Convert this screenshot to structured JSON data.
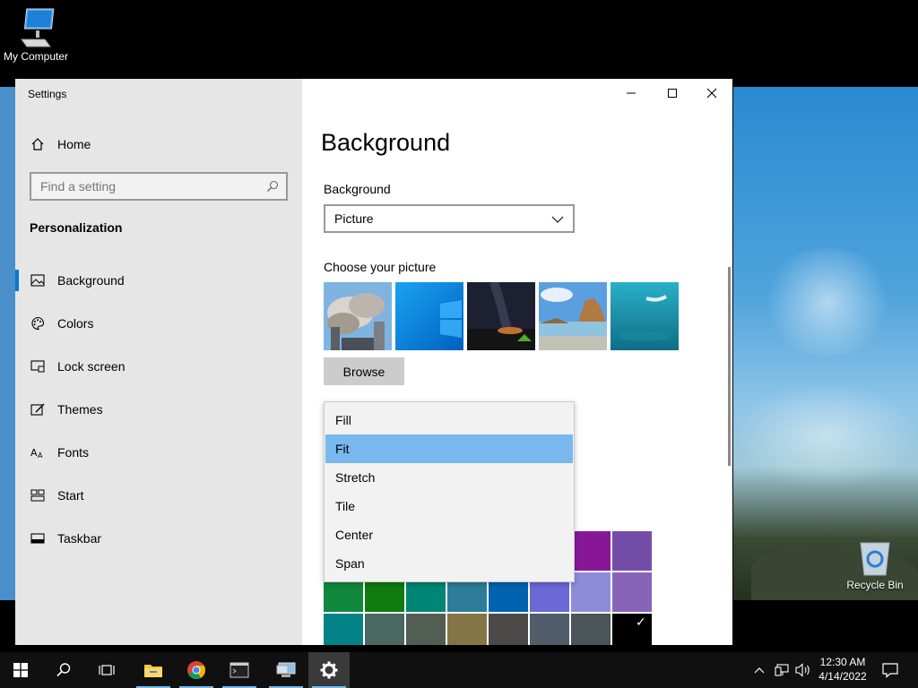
{
  "desktop": {
    "icons": [
      {
        "label": "My Computer"
      },
      {
        "label": "Recycle Bin"
      }
    ]
  },
  "window": {
    "title": "Settings",
    "controls": {
      "minimize": "minimize-icon",
      "maximize": "maximize-icon",
      "close": "close-icon"
    }
  },
  "sidebar": {
    "home_label": "Home",
    "search_placeholder": "Find a setting",
    "section_title": "Personalization",
    "items": [
      {
        "label": "Background",
        "icon": "picture-icon",
        "active": true
      },
      {
        "label": "Colors",
        "icon": "palette-icon"
      },
      {
        "label": "Lock screen",
        "icon": "lock-screen-icon"
      },
      {
        "label": "Themes",
        "icon": "themes-icon"
      },
      {
        "label": "Fonts",
        "icon": "fonts-icon"
      },
      {
        "label": "Start",
        "icon": "start-icon"
      },
      {
        "label": "Taskbar",
        "icon": "taskbar-icon"
      }
    ]
  },
  "main": {
    "title": "Background",
    "background_label": "Background",
    "background_value": "Picture",
    "choose_label": "Choose your picture",
    "browse_label": "Browse",
    "fit_options": [
      "Fill",
      "Fit",
      "Stretch",
      "Tile",
      "Center",
      "Span"
    ],
    "fit_selected": "Fit"
  },
  "colors": {
    "accent": "#0078d7",
    "swatches_row1": [
      "#881798",
      "#744da9"
    ],
    "swatches_row2": [
      "#10893e",
      "#107c10",
      "#018574",
      "#2d7d9a",
      "#0063b1",
      "#6b69d6",
      "#8e8cd8",
      "#8764b8"
    ],
    "swatches_row3": [
      "#038387",
      "#486860",
      "#525e54",
      "#847545",
      "#4c4a48",
      "#515c6b",
      "#4a5459",
      "#000000"
    ]
  },
  "taskbar": {
    "time": "12:30 AM",
    "date": "4/14/2022"
  }
}
